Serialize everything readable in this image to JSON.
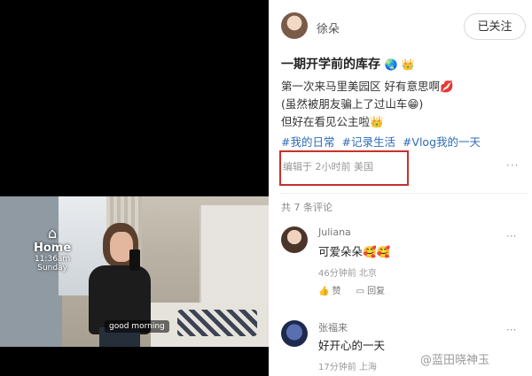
{
  "video": {
    "overlay_home": "Home",
    "overlay_time": "11:36am",
    "overlay_sub": "Sunday",
    "caption": "good morning"
  },
  "author": {
    "name": "徐朵",
    "follow_label": "已关注"
  },
  "post": {
    "title": "一期开学前的库存",
    "title_emoji": "🌏 👑",
    "lines": [
      "第一次来马里美园区 好有意思啊💋",
      "(虽然被朋友骗上了过山车😁)",
      "但好在看见公主啦👑"
    ],
    "tags": [
      "#我的日常",
      "#记录生活",
      "#Vlog我的一天"
    ],
    "meta": "编辑于 2小时前 美国",
    "more": "···"
  },
  "comments_header": "共 7 条评论",
  "comments": [
    {
      "name": "Juliana",
      "text": "可爱朵朵🥰🥰",
      "meta": "46分钟前 北京",
      "like_label": "赞",
      "reply_label": "回复",
      "more": "···"
    },
    {
      "name": "张福来",
      "text": "好开心的一天",
      "meta": "17分钟前 上海",
      "more": "···"
    }
  ],
  "watermark": "@蓝田晓神玉",
  "colors": {
    "tag_blue": "#2e6bb8",
    "highlight_red": "#c9302c"
  }
}
